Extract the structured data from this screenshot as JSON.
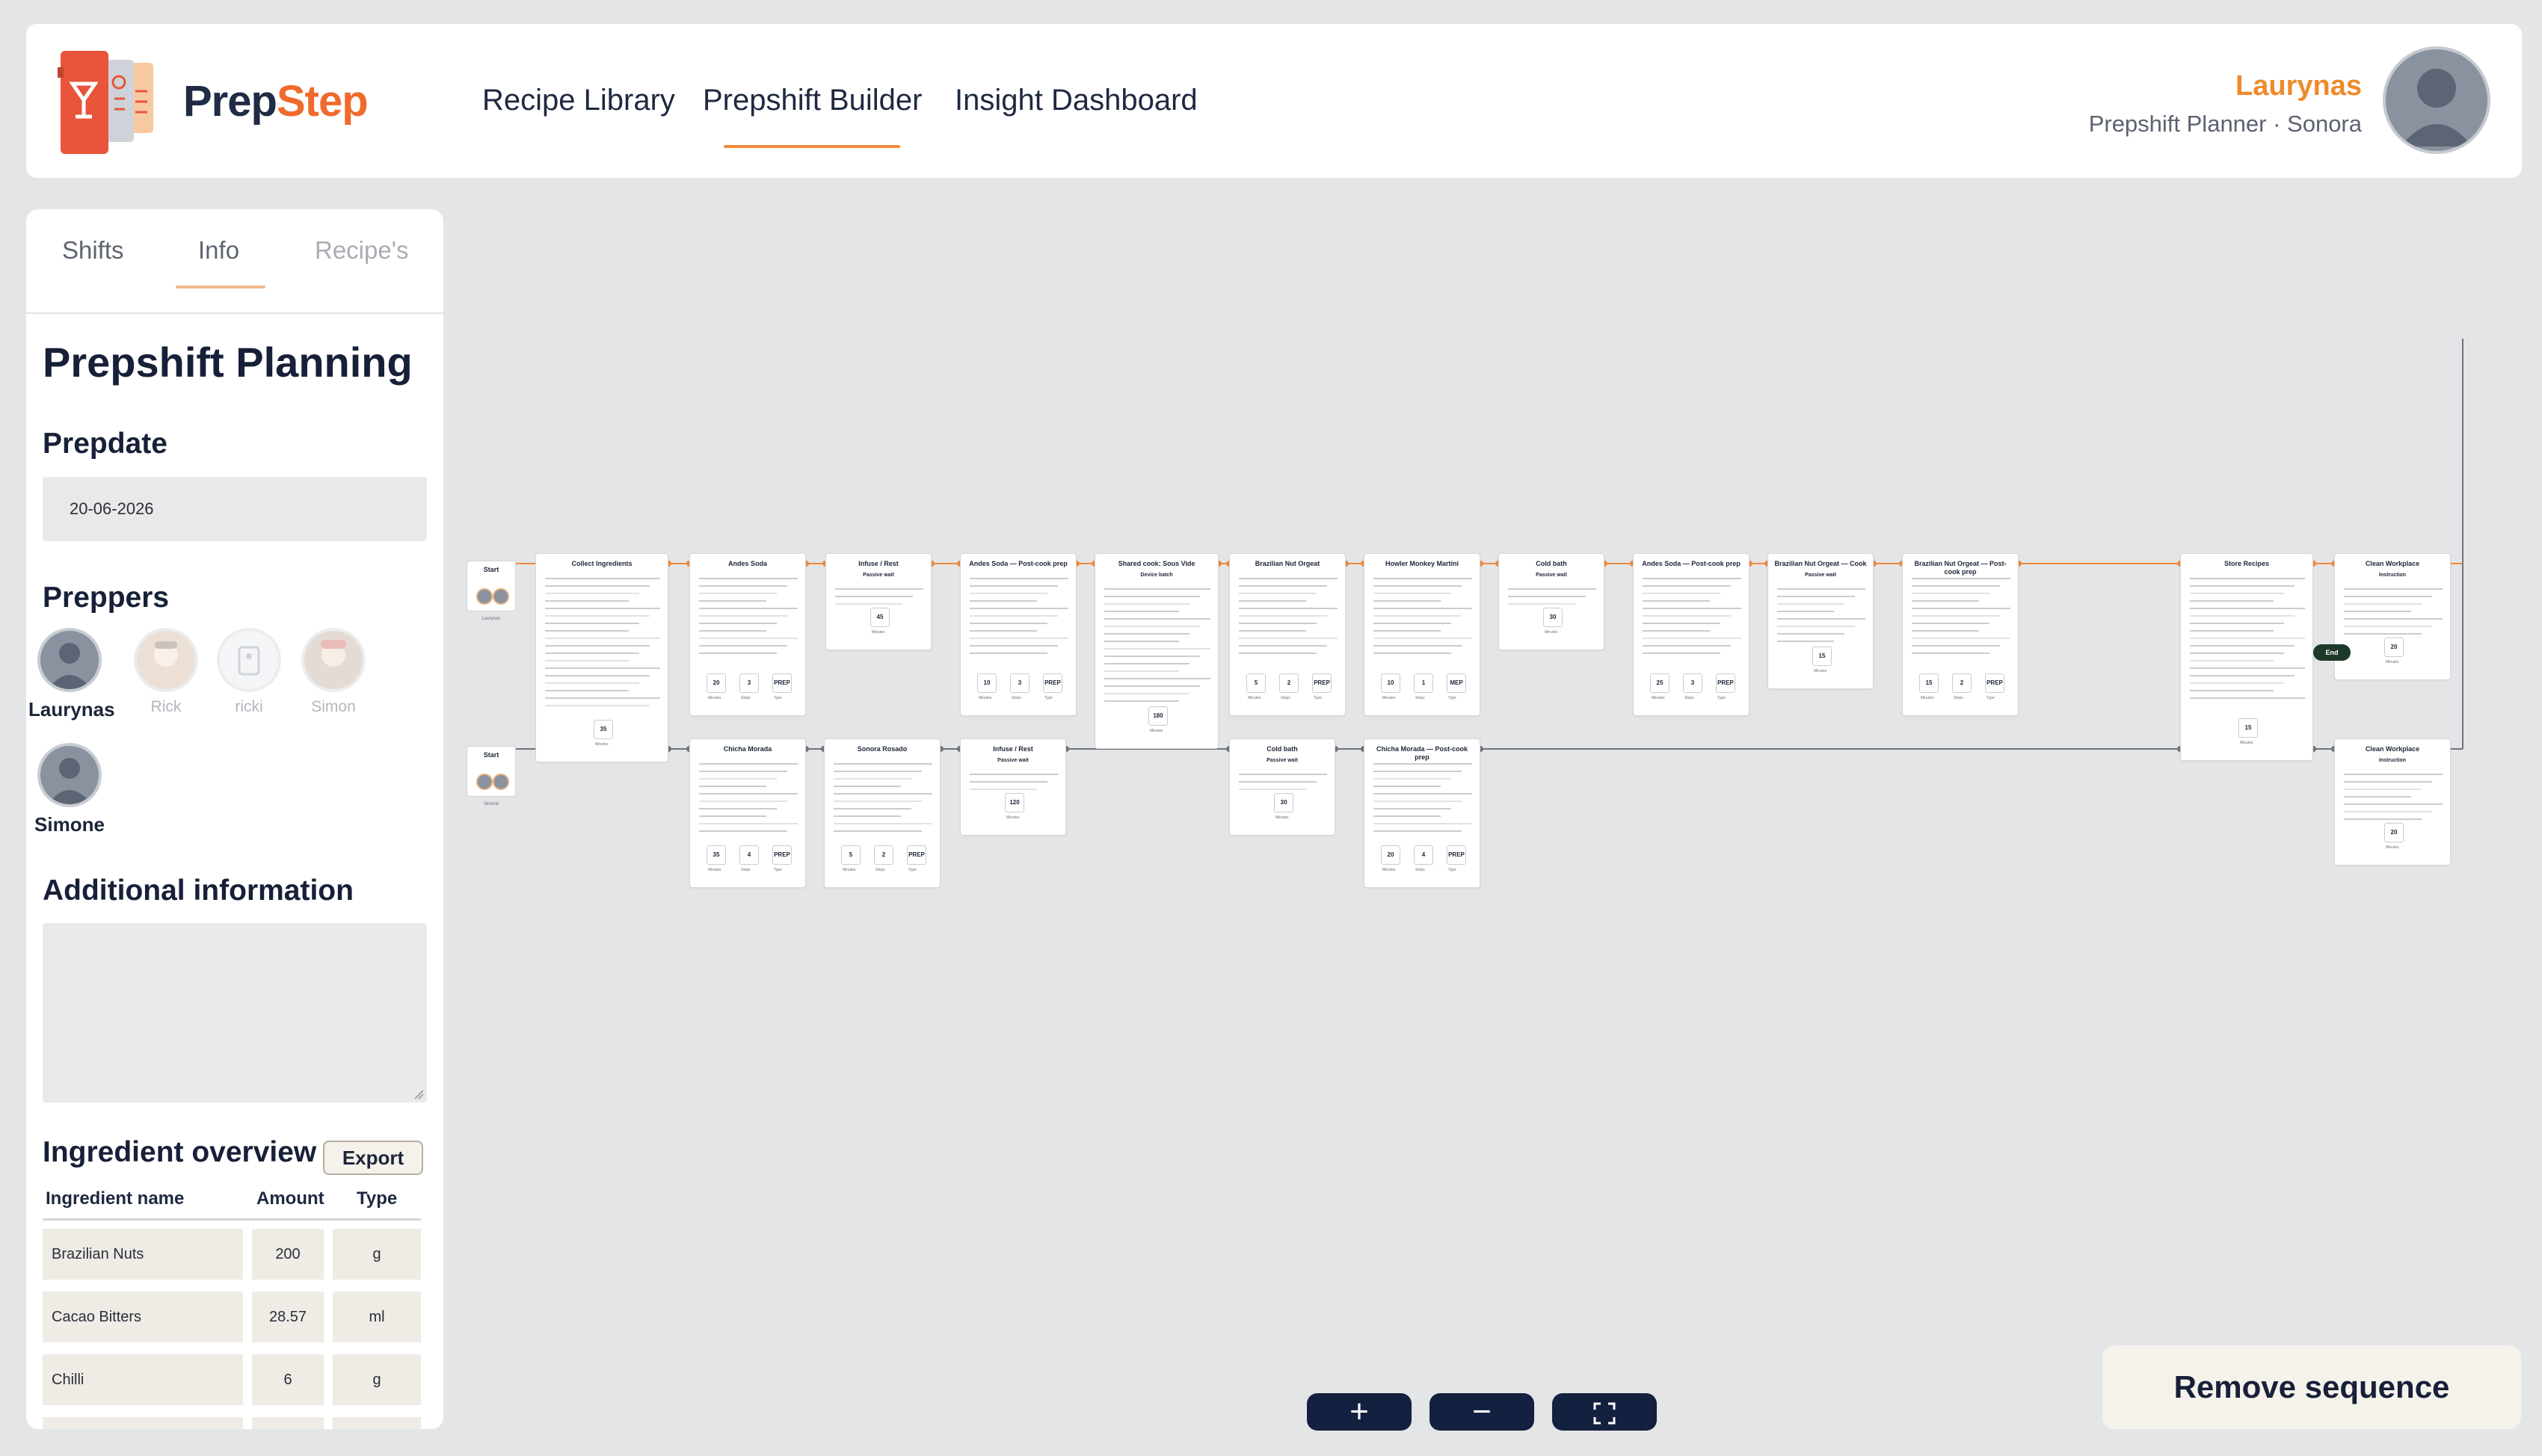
{
  "app": {
    "logo_part1": "Prep",
    "logo_part2": "Step"
  },
  "nav": [
    {
      "label": "Recipe Library"
    },
    {
      "label": "Prepshift Builder",
      "active": true
    },
    {
      "label": "Insight Dashboard"
    }
  ],
  "user": {
    "name": "Laurynas",
    "role": "Prepshift Planner · Sonora"
  },
  "sidebar": {
    "tabs": [
      {
        "label": "Shifts"
      },
      {
        "label": "Info",
        "active": true
      },
      {
        "label": "Recipe's",
        "disabled": true
      }
    ],
    "title": "Prepshift Planning",
    "predate_heading": "Prepdate",
    "predate_value": "20-06-2026",
    "preppers_heading": "Preppers",
    "preppers": [
      {
        "name": "Laurynas",
        "active": true
      },
      {
        "name": "Rick",
        "active": false
      },
      {
        "name": "ricki",
        "active": false
      },
      {
        "name": "Simon",
        "active": false
      },
      {
        "name": "Simone",
        "active": true
      }
    ],
    "additional_heading": "Additional information",
    "ingredient_heading": "Ingredient overview",
    "export_label": "Export",
    "table_headers": {
      "name": "Ingredient name",
      "amount": "Amount",
      "type": "Type"
    },
    "ingredients": [
      {
        "name": "Brazilian Nuts",
        "amount": "200",
        "type": "g"
      },
      {
        "name": "Cacao Bitters",
        "amount": "28.57",
        "type": "ml"
      },
      {
        "name": "Chilli",
        "amount": "6",
        "type": "g"
      }
    ]
  },
  "flow": {
    "start_label": "Start",
    "end_label": "End",
    "start_nodes": [
      {
        "user": "Laurynas"
      },
      {
        "user": "Simone"
      }
    ],
    "row1": [
      {
        "title": "Collect Ingredients",
        "minutes": "35",
        "minutes_label": "Minutes"
      },
      {
        "title": "Andes Soda",
        "minutes": "20",
        "steps": "3",
        "type": "PREP"
      },
      {
        "title": "Infuse / Rest",
        "sub": "Passive wait",
        "minutes": "45"
      },
      {
        "title": "Andes Soda — Post-cook prep",
        "minutes": "10",
        "steps": "3",
        "type": "PREP"
      },
      {
        "title": "Shared cook: Sous Vide",
        "sub": "Device batch",
        "minutes": "180"
      },
      {
        "title": "Brazilian Nut Orgeat",
        "minutes": "5",
        "steps": "2",
        "type": "PREP"
      },
      {
        "title": "Howler Monkey Martini",
        "minutes": "10",
        "steps": "1",
        "type": "MEP"
      },
      {
        "title": "Cold bath",
        "sub": "Passive wait",
        "minutes": "30"
      },
      {
        "title": "Andes Soda — Post-cook prep",
        "minutes": "25",
        "steps": "3",
        "type": "PREP"
      },
      {
        "title": "Brazilian Nut Orgeat — Cook",
        "sub": "Passive wait",
        "minutes": "15"
      },
      {
        "title": "Brazilian Nut Orgeat — Post-cook prep",
        "minutes": "15",
        "steps": "2",
        "type": "PREP"
      },
      {
        "title": "Store Recipes",
        "minutes": "15"
      },
      {
        "title": "Clean Workplace",
        "sub": "Instruction",
        "minutes": "20"
      }
    ],
    "row2": [
      {
        "title": "Chicha Morada",
        "minutes": "35",
        "steps": "4",
        "type": "PREP"
      },
      {
        "title": "Sonora Rosado",
        "minutes": "5",
        "steps": "2",
        "type": "PREP"
      },
      {
        "title": "Infuse / Rest",
        "sub": "Passive wait",
        "minutes": "120"
      },
      {
        "title": "Cold bath",
        "sub": "Passive wait",
        "minutes": "30"
      },
      {
        "title": "Chicha Morada — Post-cook prep",
        "minutes": "20",
        "steps": "4",
        "type": "PREP"
      },
      {
        "title": "Clean Workplace",
        "sub": "Instruction",
        "minutes": "20"
      }
    ]
  },
  "controls": {
    "zoom_in": "+",
    "zoom_out": "−",
    "fit": "⛶",
    "remove": "Remove sequence"
  },
  "colors": {
    "accent": "#ef8a2c",
    "brand_red": "#e8553a",
    "navy": "#14203f"
  }
}
